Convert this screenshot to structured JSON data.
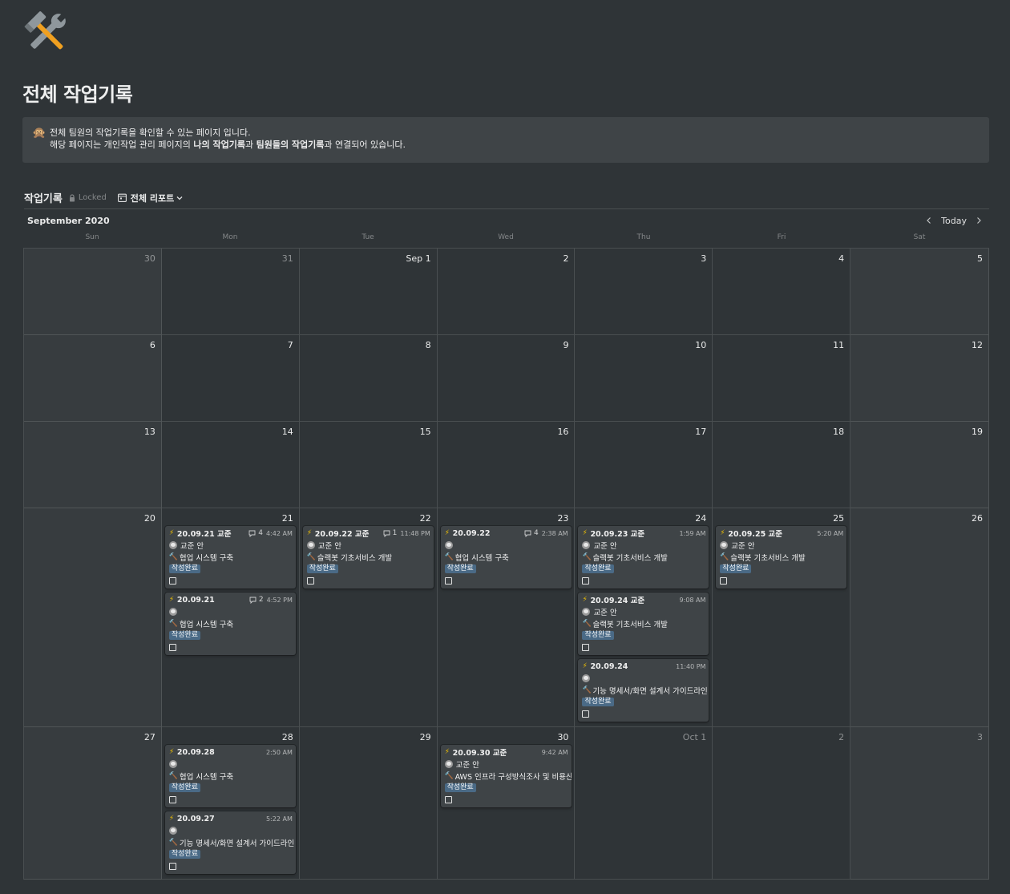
{
  "page": {
    "title": "전체 작업기록",
    "icon": "hammer-and-wrench-icon"
  },
  "callout": {
    "icon": "monkey-face-icon",
    "line1": "전체 팀원의 작업기록을 확인할 수 있는 페이지 입니다.",
    "line2_prefix": "해당 페이지는 개인작업 관리 페이지의 ",
    "line2_bold1": "나의 작업기록",
    "line2_mid": "과 ",
    "line2_bold2": "팀원들의 작업기록",
    "line2_suffix": "과 연결되어 있습니다."
  },
  "database": {
    "title": "작업기록",
    "lock_label": "Locked",
    "view_label": "전체 리포트"
  },
  "calendar": {
    "month_label": "September 2020",
    "today_label": "Today",
    "weekdays": [
      "Sun",
      "Mon",
      "Tue",
      "Wed",
      "Thu",
      "Fri",
      "Sat"
    ],
    "weeks": [
      {
        "days": [
          {
            "num": "30",
            "muted": true,
            "cards": []
          },
          {
            "num": "31",
            "muted": true,
            "cards": []
          },
          {
            "num": "Sep 1",
            "muted": false,
            "cards": []
          },
          {
            "num": "2",
            "muted": false,
            "cards": []
          },
          {
            "num": "3",
            "muted": false,
            "cards": []
          },
          {
            "num": "4",
            "muted": false,
            "cards": []
          },
          {
            "num": "5",
            "muted": false,
            "cards": []
          }
        ]
      },
      {
        "days": [
          {
            "num": "6",
            "muted": false,
            "cards": []
          },
          {
            "num": "7",
            "muted": false,
            "cards": []
          },
          {
            "num": "8",
            "muted": false,
            "cards": []
          },
          {
            "num": "9",
            "muted": false,
            "cards": []
          },
          {
            "num": "10",
            "muted": false,
            "cards": []
          },
          {
            "num": "11",
            "muted": false,
            "cards": []
          },
          {
            "num": "12",
            "muted": false,
            "cards": []
          }
        ]
      },
      {
        "days": [
          {
            "num": "13",
            "muted": false,
            "cards": []
          },
          {
            "num": "14",
            "muted": false,
            "cards": []
          },
          {
            "num": "15",
            "muted": false,
            "cards": []
          },
          {
            "num": "16",
            "muted": false,
            "cards": []
          },
          {
            "num": "17",
            "muted": false,
            "cards": []
          },
          {
            "num": "18",
            "muted": false,
            "cards": []
          },
          {
            "num": "19",
            "muted": false,
            "cards": []
          }
        ]
      },
      {
        "days": [
          {
            "num": "20",
            "muted": false,
            "cards": []
          },
          {
            "num": "21",
            "muted": false,
            "cards": [
              {
                "title": "20.09.21 교준",
                "comments": "4",
                "time": "4:42 AM",
                "person": "교준 안",
                "project": "협업 시스템 구축",
                "status": "작성완료"
              },
              {
                "title": "20.09.21",
                "comments": "2",
                "time": "4:52 PM",
                "person": "",
                "project": "협업 시스템 구축",
                "status": "작성완료"
              }
            ]
          },
          {
            "num": "22",
            "muted": false,
            "cards": [
              {
                "title": "20.09.22 교준",
                "comments": "1",
                "time": "11:48 PM",
                "person": "교준 안",
                "project": "슬랙봇 기초서비스 개발",
                "status": "작성완료"
              }
            ]
          },
          {
            "num": "23",
            "muted": false,
            "cards": [
              {
                "title": "20.09.22",
                "comments": "4",
                "time": "2:38 AM",
                "person": "",
                "project": "협업 시스템 구축",
                "status": "작성완료"
              }
            ]
          },
          {
            "num": "24",
            "muted": false,
            "cards": [
              {
                "title": "20.09.23 교준",
                "comments": "",
                "time": "1:59 AM",
                "person": "교준 안",
                "project": "슬랙봇 기초서비스 개발",
                "status": "작성완료"
              },
              {
                "title": "20.09.24 교준",
                "comments": "",
                "time": "9:08 AM",
                "person": "교준 안",
                "project": "슬랙봇 기초서비스 개발",
                "status": "작성완료"
              },
              {
                "title": "20.09.24",
                "comments": "",
                "time": "11:40 PM",
                "person": "",
                "project": "기능 명세서/화면 설계서 가이드라인",
                "status": "작성완료"
              }
            ]
          },
          {
            "num": "25",
            "muted": false,
            "cards": [
              {
                "title": "20.09.25 교준",
                "comments": "",
                "time": "5:20 AM",
                "person": "교준 안",
                "project": "슬랙봇 기초서비스 개발",
                "status": "작성완료"
              }
            ]
          },
          {
            "num": "26",
            "muted": false,
            "cards": []
          }
        ]
      },
      {
        "days": [
          {
            "num": "27",
            "muted": false,
            "cards": []
          },
          {
            "num": "28",
            "muted": false,
            "cards": [
              {
                "title": "20.09.28",
                "comments": "",
                "time": "2:50 AM",
                "person": "",
                "project": "협업 시스템 구축",
                "status": "작성완료"
              },
              {
                "title": "20.09.27",
                "comments": "",
                "time": "5:22 AM",
                "person": "",
                "project": "기능 명세서/화면 설계서 가이드라인",
                "status": "작성완료"
              }
            ]
          },
          {
            "num": "29",
            "muted": false,
            "cards": []
          },
          {
            "num": "30",
            "muted": false,
            "cards": [
              {
                "title": "20.09.30 교준",
                "comments": "",
                "time": "9:42 AM",
                "person": "교준 안",
                "project": "AWS 인프라 구성방식조사 및 비용산정",
                "status": "작성완료"
              }
            ]
          },
          {
            "num": "Oct 1",
            "muted": true,
            "cards": []
          },
          {
            "num": "2",
            "muted": true,
            "cards": []
          },
          {
            "num": "3",
            "muted": true,
            "cards": []
          }
        ]
      }
    ]
  },
  "colors": {
    "background": "#2f3437",
    "card": "#3f4447",
    "badge": "#4a6a86",
    "bolt": "#f5c400"
  }
}
